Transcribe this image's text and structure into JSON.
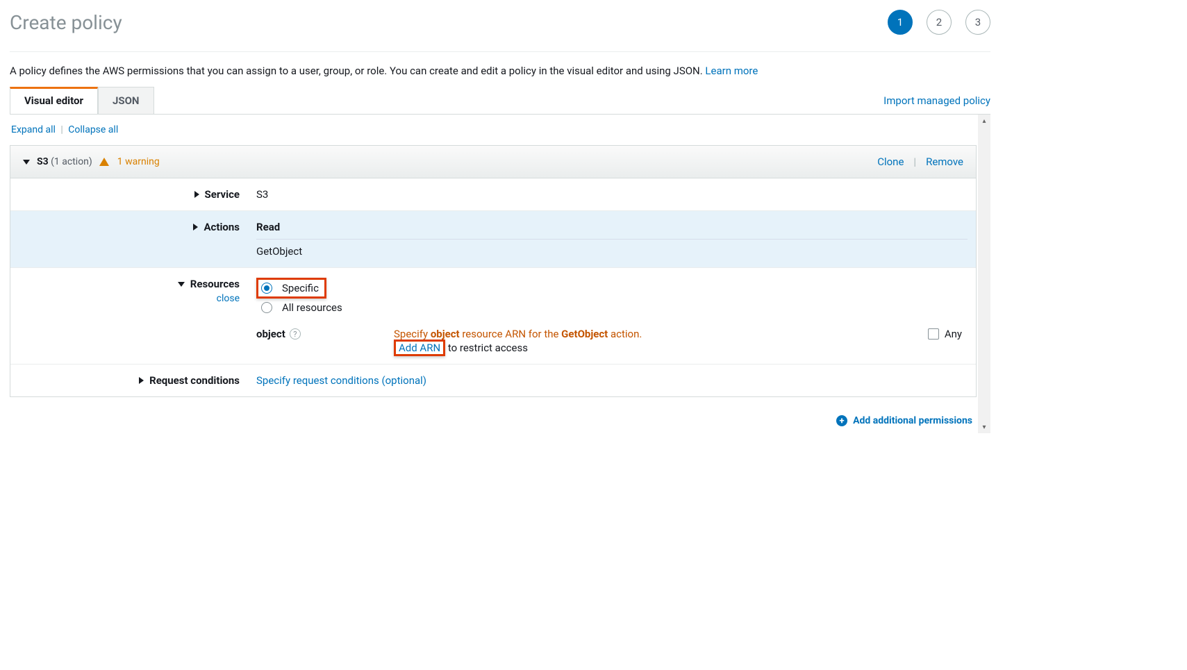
{
  "header": {
    "title": "Create policy"
  },
  "steps": [
    "1",
    "2",
    "3"
  ],
  "intro": {
    "text": "A policy defines the AWS permissions that you can assign to a user, group, or role. You can create and edit a policy in the visual editor and using JSON. ",
    "learn_more": "Learn more"
  },
  "tabs": {
    "visual": "Visual editor",
    "json": "JSON",
    "import": "Import managed policy"
  },
  "expand": {
    "expand_all": "Expand all",
    "collapse_all": "Collapse all"
  },
  "panel": {
    "service": "S3",
    "action_count": "(1 action)",
    "warning": "1 warning",
    "clone": "Clone",
    "remove": "Remove"
  },
  "rows": {
    "service_label": "Service",
    "service_value": "S3",
    "actions_label": "Actions",
    "actions_read": "Read",
    "actions_value": "GetObject",
    "resources_label": "Resources",
    "close": "close",
    "specific": "Specific",
    "all_resources": "All resources",
    "object_label": "object",
    "specify_prefix": "Specify ",
    "specify_obj": "object",
    "specify_mid": " resource ARN for the ",
    "specify_action": "GetObject",
    "specify_suffix": " action.",
    "add_arn": "Add ARN",
    "restrict_suffix": " to restrict access",
    "any": "Any",
    "conditions_label": "Request conditions",
    "conditions_value": "Specify request conditions (optional)"
  },
  "footer": {
    "add_permissions": "Add additional permissions"
  }
}
